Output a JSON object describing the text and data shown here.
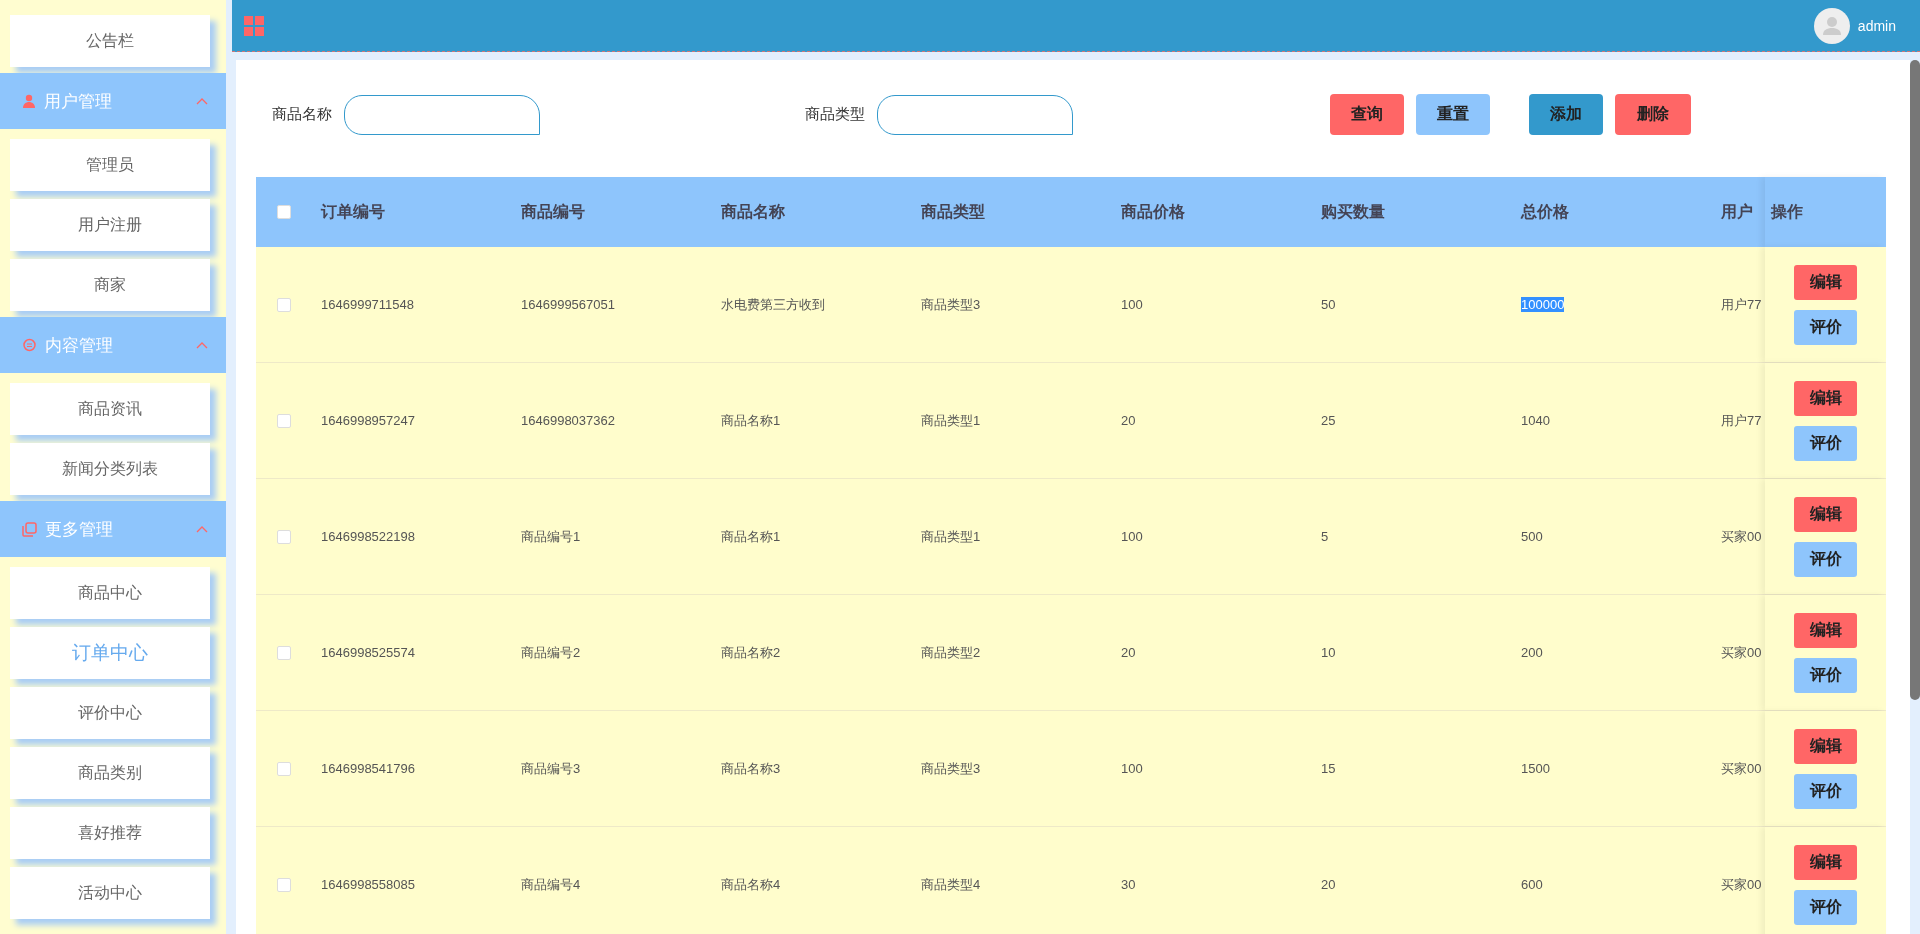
{
  "topbar": {
    "user": "admin"
  },
  "sidebar": [
    {
      "kind": "item",
      "label": "公告栏",
      "selected": false
    },
    {
      "kind": "group",
      "label": "用户管理",
      "expanded": true,
      "children": [
        {
          "label": "管理员",
          "selected": false
        },
        {
          "label": "用户注册",
          "selected": false
        },
        {
          "label": "商家",
          "selected": false
        }
      ]
    },
    {
      "kind": "group",
      "label": "内容管理",
      "expanded": true,
      "children": [
        {
          "label": "商品资讯",
          "selected": false
        },
        {
          "label": "新闻分类列表",
          "selected": false
        }
      ]
    },
    {
      "kind": "group",
      "label": "更多管理",
      "expanded": true,
      "children": [
        {
          "label": "商品中心",
          "selected": false
        },
        {
          "label": "订单中心",
          "selected": true
        },
        {
          "label": "评价中心",
          "selected": false
        },
        {
          "label": "商品类别",
          "selected": false
        },
        {
          "label": "喜好推荐",
          "selected": false
        },
        {
          "label": "活动中心",
          "selected": false
        }
      ]
    }
  ],
  "filters": [
    {
      "label": "商品名称"
    },
    {
      "label": "商品类型"
    }
  ],
  "buttons": [
    {
      "label": "查询",
      "kind": "danger"
    },
    {
      "label": "重置",
      "kind": "light"
    },
    {
      "label": "添加",
      "kind": "primary"
    },
    {
      "label": "删除",
      "kind": "danger"
    }
  ],
  "table": {
    "all_checked": false,
    "columns": [
      "订单编号",
      "商品编号",
      "商品名称",
      "商品类型",
      "商品价格",
      "购买数量",
      "总价格",
      "用户",
      "操作"
    ],
    "rows": [
      {
        "checked": false,
        "total_highlighted": true,
        "cells": [
          "1646999711548",
          "1646999567051",
          "水电费第三方收到",
          "商品类型3",
          "100",
          "50",
          "100000",
          "用户77"
        ],
        "actions": [
          "编辑",
          "评价"
        ]
      },
      {
        "checked": false,
        "total_highlighted": false,
        "cells": [
          "1646998957247",
          "1646998037362",
          "商品名称1",
          "商品类型1",
          "20",
          "25",
          "1040",
          "用户77"
        ],
        "actions": [
          "编辑",
          "评价"
        ]
      },
      {
        "checked": false,
        "total_highlighted": false,
        "cells": [
          "1646998522198",
          "商品编号1",
          "商品名称1",
          "商品类型1",
          "100",
          "5",
          "500",
          "买家00"
        ],
        "actions": [
          "编辑",
          "评价"
        ]
      },
      {
        "checked": false,
        "total_highlighted": false,
        "cells": [
          "1646998525574",
          "商品编号2",
          "商品名称2",
          "商品类型2",
          "20",
          "10",
          "200",
          "买家00"
        ],
        "actions": [
          "编辑",
          "评价"
        ]
      },
      {
        "checked": false,
        "total_highlighted": false,
        "cells": [
          "1646998541796",
          "商品编号3",
          "商品名称3",
          "商品类型3",
          "100",
          "15",
          "1500",
          "买家00"
        ],
        "actions": [
          "编辑",
          "评价"
        ]
      },
      {
        "checked": false,
        "total_highlighted": false,
        "cells": [
          "1646998558085",
          "商品编号4",
          "商品名称4",
          "商品类型4",
          "30",
          "20",
          "600",
          "买家00"
        ],
        "actions": [
          "编辑",
          "评价"
        ]
      }
    ]
  }
}
